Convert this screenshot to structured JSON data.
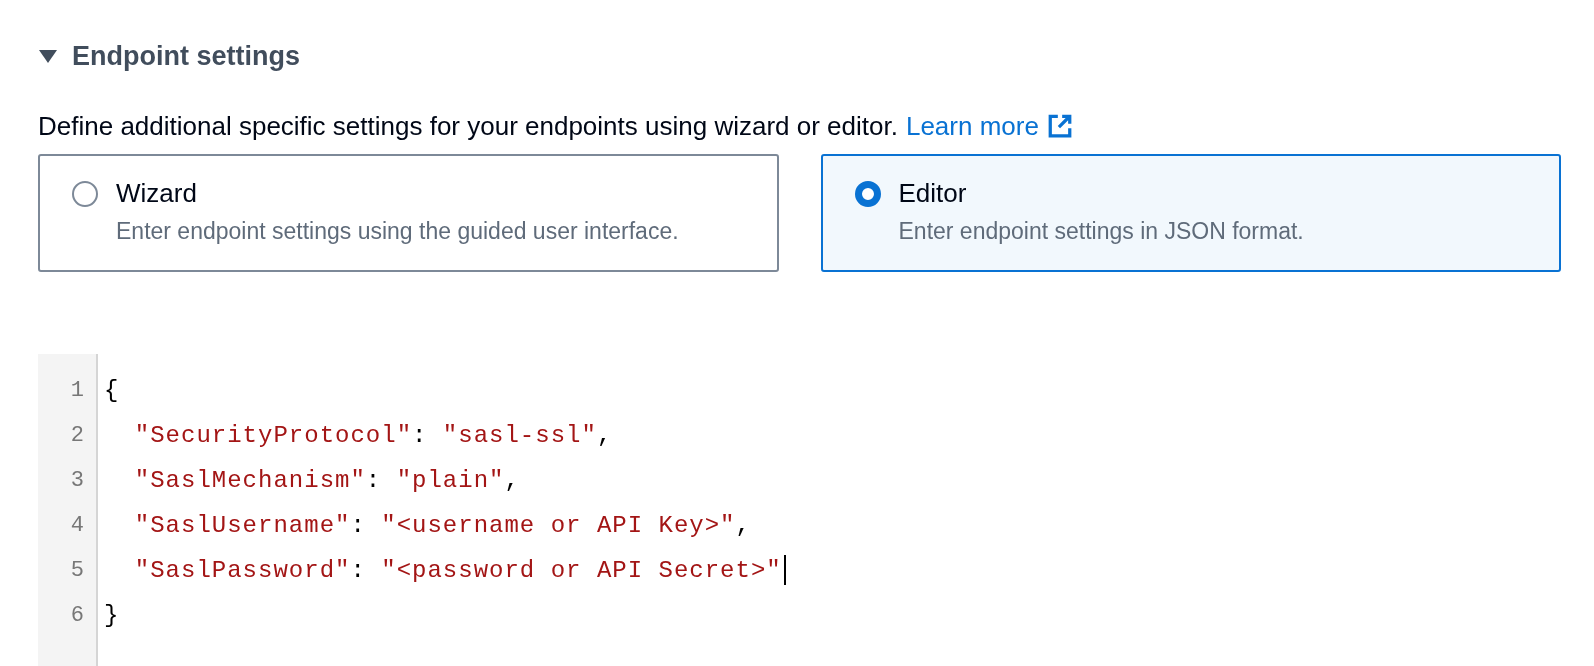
{
  "section": {
    "title": "Endpoint settings",
    "expanded": true
  },
  "description": {
    "text": "Define additional specific settings for your endpoints using wizard or editor.",
    "link": "Learn more"
  },
  "options": [
    {
      "label": "Wizard",
      "description": "Enter endpoint settings using the guided user interface.",
      "selected": false
    },
    {
      "label": "Editor",
      "description": "Enter endpoint settings in JSON format.",
      "selected": true
    }
  ],
  "editor": {
    "lines": [
      {
        "number": "1",
        "cursor": false,
        "tokens": [
          {
            "kind": "punct",
            "text": "{"
          }
        ]
      },
      {
        "number": "2",
        "cursor": false,
        "tokens": [
          {
            "kind": "string",
            "text": "  \"SecurityProtocol\""
          },
          {
            "kind": "punct",
            "text": ": "
          },
          {
            "kind": "string",
            "text": "\"sasl-ssl\""
          },
          {
            "kind": "punct",
            "text": ","
          }
        ]
      },
      {
        "number": "3",
        "cursor": false,
        "tokens": [
          {
            "kind": "string",
            "text": "  \"SaslMechanism\""
          },
          {
            "kind": "punct",
            "text": ": "
          },
          {
            "kind": "string",
            "text": "\"plain\""
          },
          {
            "kind": "punct",
            "text": ","
          }
        ]
      },
      {
        "number": "4",
        "cursor": false,
        "tokens": [
          {
            "kind": "string",
            "text": "  \"SaslUsername\""
          },
          {
            "kind": "punct",
            "text": ": "
          },
          {
            "kind": "string",
            "text": "\"<username or API Key>\""
          },
          {
            "kind": "punct",
            "text": ","
          }
        ]
      },
      {
        "number": "5",
        "cursor": true,
        "tokens": [
          {
            "kind": "string",
            "text": "  \"SaslPassword\""
          },
          {
            "kind": "punct",
            "text": ": "
          },
          {
            "kind": "string",
            "text": "\"<password or API Secret>\""
          }
        ]
      },
      {
        "number": "6",
        "cursor": false,
        "tokens": [
          {
            "kind": "punct",
            "text": "}"
          }
        ]
      }
    ]
  }
}
